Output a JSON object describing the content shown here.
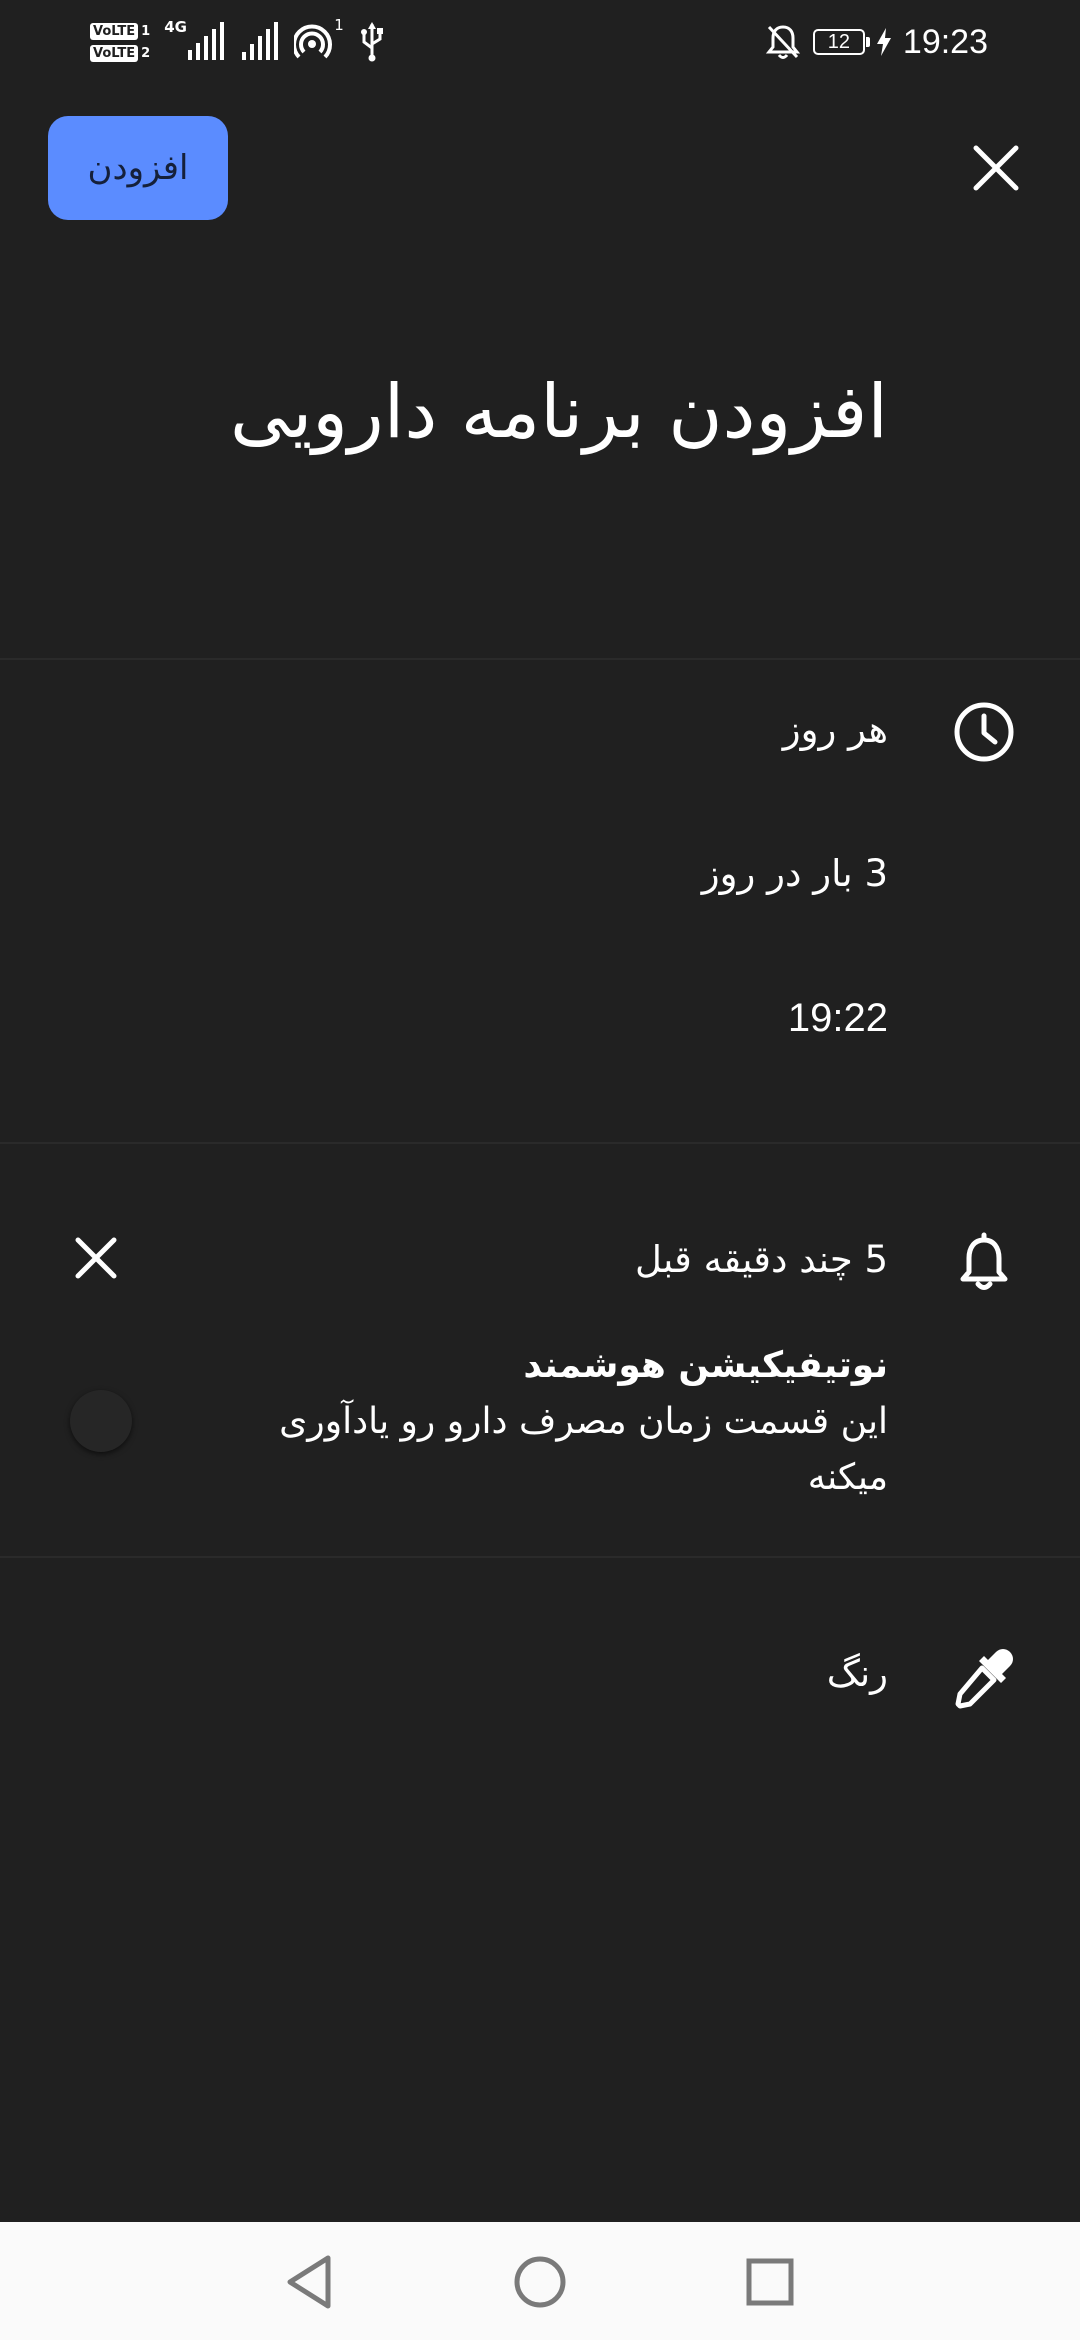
{
  "status_bar": {
    "volte_1": "VoLTE",
    "volte_1_sim": "1",
    "volte_2": "VoLTE",
    "volte_2_sim": "2",
    "network_type": "4G",
    "hotspot_count": "1",
    "battery_level": "12",
    "time": "19:23",
    "icons": [
      "signal-icon",
      "signal-icon",
      "hotspot-icon",
      "usb-icon",
      "mute-bell-icon",
      "battery-icon",
      "charging-icon"
    ]
  },
  "header": {
    "add_label": "افزودن",
    "close_icon": "close-icon"
  },
  "page_title": "افزودن برنامه دارویی",
  "schedule": {
    "icon": "clock-icon",
    "frequency": "هر روز",
    "times_per_day": "3 بار در روز",
    "time": "19:22"
  },
  "reminder": {
    "icon": "bell-icon",
    "offset": "5 چند دقیقه قبل",
    "remove_icon": "close-icon",
    "smart_notification_title": "نوتیفیکیشن هوشمند",
    "smart_notification_desc": "این قسمت زمان مصرف دارو رو یادآوری میکنه",
    "smart_notification_enabled": false
  },
  "color_row": {
    "icon": "eyedropper-icon",
    "label": "رنگ"
  },
  "nav_bar": {
    "icons": [
      "back-icon",
      "home-icon",
      "recents-icon"
    ]
  },
  "colors": {
    "background": "#202020",
    "accent": "#5b8cff",
    "text": "#ffffff",
    "nav_bar": "#fafafa"
  }
}
